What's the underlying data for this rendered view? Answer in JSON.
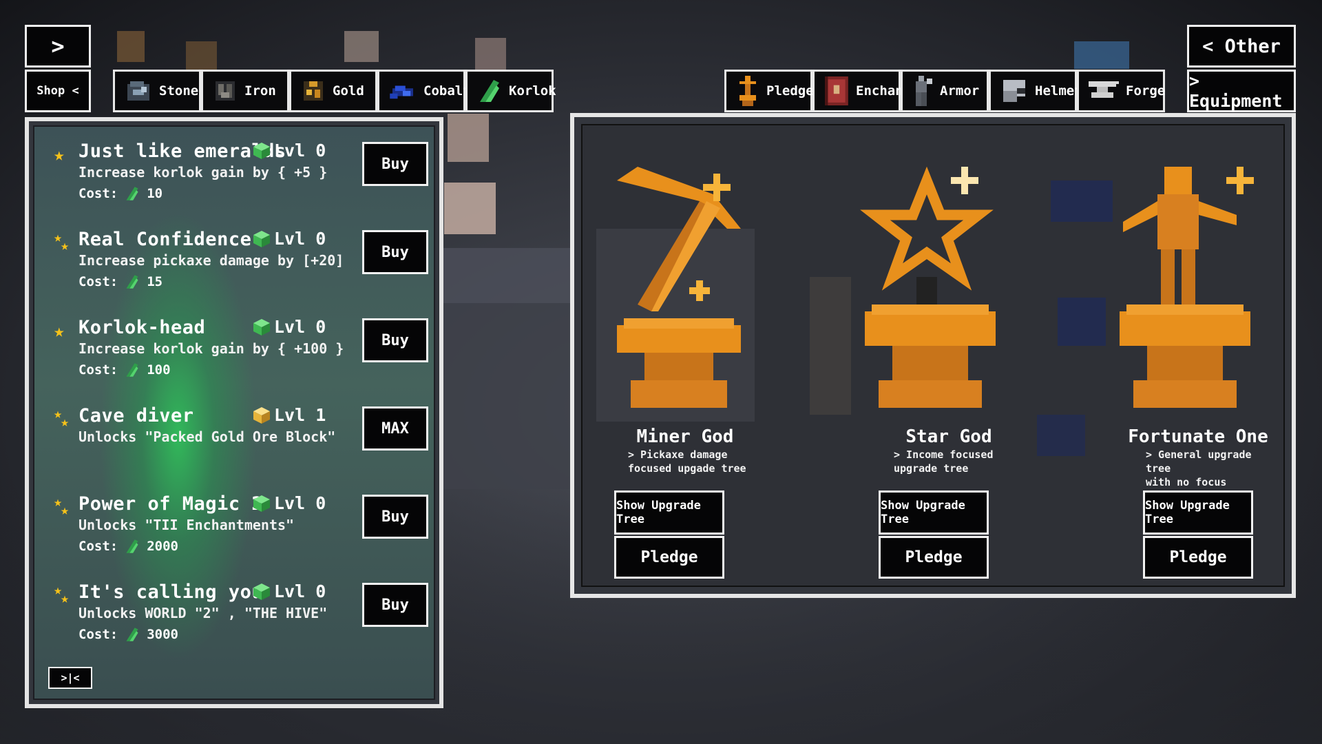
{
  "nav": {
    "collapse_arrow": ">",
    "shop_label": "Shop <",
    "other_label": "< Other",
    "equipment_label": "> Equipment"
  },
  "resource_tabs": [
    {
      "label": "Stone",
      "icon": "stone-ore-icon"
    },
    {
      "label": "Iron",
      "icon": "iron-ore-icon"
    },
    {
      "label": "Gold",
      "icon": "gold-ore-icon"
    },
    {
      "label": "Cobalt",
      "icon": "cobalt-ore-icon"
    },
    {
      "label": "Korlok",
      "icon": "korlok-crystal-icon"
    }
  ],
  "equipment_tabs": [
    {
      "label": "Pledge",
      "icon": "trophy-icon"
    },
    {
      "label": "Enchant",
      "icon": "spellbook-icon"
    },
    {
      "label": "Armor",
      "icon": "armor-icon"
    },
    {
      "label": "Helmet",
      "icon": "helmet-icon"
    },
    {
      "label": "Forge",
      "icon": "anvil-icon"
    }
  ],
  "upgrades": [
    {
      "title": "Just like emeralds",
      "level": "Lvl 0",
      "desc": "Increase korlok gain by { +5 }",
      "cost_label": "Cost:",
      "cost": "10",
      "button": "Buy",
      "star": "single",
      "cube": "green"
    },
    {
      "title": "Real Confidence",
      "level": "Lvl 0",
      "desc": "Increase pickaxe damage by [+20]",
      "cost_label": "Cost:",
      "cost": "15",
      "button": "Buy",
      "star": "double",
      "cube": "green"
    },
    {
      "title": "Korlok-head",
      "level": "Lvl 0",
      "desc": "Increase korlok gain by { +100 }",
      "cost_label": "Cost:",
      "cost": "100",
      "button": "Buy",
      "star": "single",
      "cube": "green"
    },
    {
      "title": "Cave diver",
      "level": "Lvl 1",
      "desc": "Unlocks \"Packed Gold Ore Block\"",
      "cost_label": "",
      "cost": "",
      "button": "MAX",
      "star": "double",
      "cube": "gold"
    },
    {
      "title": "Power of Magic 2",
      "level": "Lvl 0",
      "desc": "Unlocks \"TII Enchantments\"",
      "cost_label": "Cost:",
      "cost": "2000",
      "button": "Buy",
      "star": "double",
      "cube": "green"
    },
    {
      "title": "It's calling you",
      "level": "Lvl 0",
      "desc": "Unlocks WORLD \"2\" , \"THE HIVE\"",
      "cost_label": "Cost:",
      "cost": "3000",
      "button": "Buy",
      "star": "double",
      "cube": "green"
    }
  ],
  "collapse_small": ">|<",
  "gods": [
    {
      "name": "Miner God",
      "desc_line1": "> Pickaxe damage",
      "desc_line2": "focused upgade tree",
      "show_tree": "Show Upgrade Tree",
      "pledge": "Pledge",
      "icon": "pickaxe-statue-icon"
    },
    {
      "name": "Star God",
      "desc_line1": "> Income focused",
      "desc_line2": "upgrade tree",
      "show_tree": "Show Upgrade Tree",
      "pledge": "Pledge",
      "icon": "star-statue-icon"
    },
    {
      "name": "Fortunate One",
      "desc_line1": "> General upgrade tree",
      "desc_line2": "with no focus",
      "show_tree": "Show Upgrade Tree",
      "pledge": "Pledge",
      "icon": "figure-statue-icon"
    }
  ],
  "colors": {
    "gold_statue": "#e8901c",
    "korlok_green": "#3fc25a",
    "star_yellow": "#f6c21a",
    "panel_border": "#e4e4e4"
  }
}
